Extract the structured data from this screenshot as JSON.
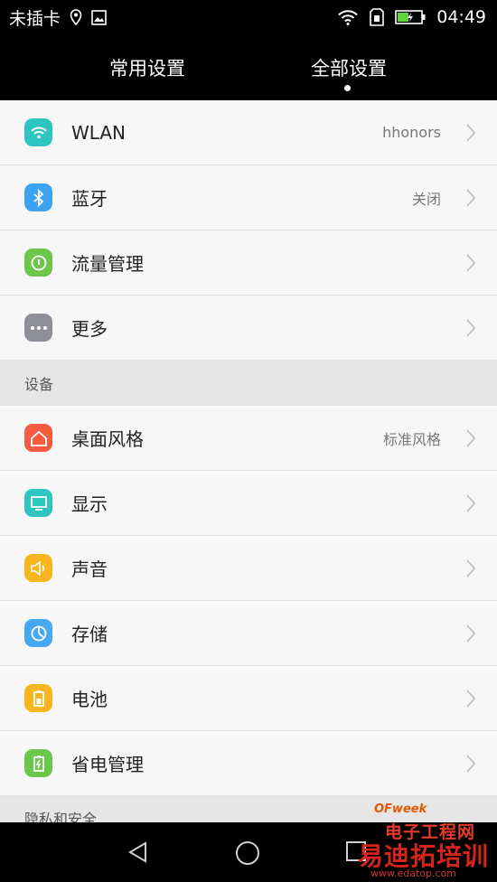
{
  "status": {
    "carrier": "未插卡",
    "time": "04:49"
  },
  "tabs": [
    {
      "label": "常用设置"
    },
    {
      "label": "全部设置"
    }
  ],
  "colors": {
    "wlan": "#2ec4c0",
    "bluetooth": "#3ea2f2",
    "data": "#6cc64a",
    "more": "#8e8e97",
    "theme": "#f45b3f",
    "display": "#2ec4c0",
    "sound": "#f8b51d",
    "storage": "#45a8f0",
    "battery": "#f8b51d",
    "power": "#6cc64a"
  },
  "rows_group1": [
    {
      "label": "WLAN",
      "value": "hhonors",
      "icon": "wifi-icon"
    },
    {
      "label": "蓝牙",
      "value": "关闭",
      "icon": "bluetooth-icon"
    },
    {
      "label": "流量管理",
      "value": "",
      "icon": "data-usage-icon"
    },
    {
      "label": "更多",
      "value": "",
      "icon": "more-icon"
    }
  ],
  "section_device": "设备",
  "rows_group2": [
    {
      "label": "桌面风格",
      "value": "标准风格",
      "icon": "home-icon"
    },
    {
      "label": "显示",
      "value": "",
      "icon": "display-icon"
    },
    {
      "label": "声音",
      "value": "",
      "icon": "speaker-icon"
    },
    {
      "label": "存储",
      "value": "",
      "icon": "storage-icon"
    },
    {
      "label": "电池",
      "value": "",
      "icon": "battery-icon"
    },
    {
      "label": "省电管理",
      "value": "",
      "icon": "power-saving-icon"
    }
  ],
  "section_privacy": "隐私和安全",
  "watermark": {
    "brand": "OFweek",
    "line1": "电子工程网",
    "line2": "易迪拓培训",
    "line3": "www.edatop.com"
  }
}
